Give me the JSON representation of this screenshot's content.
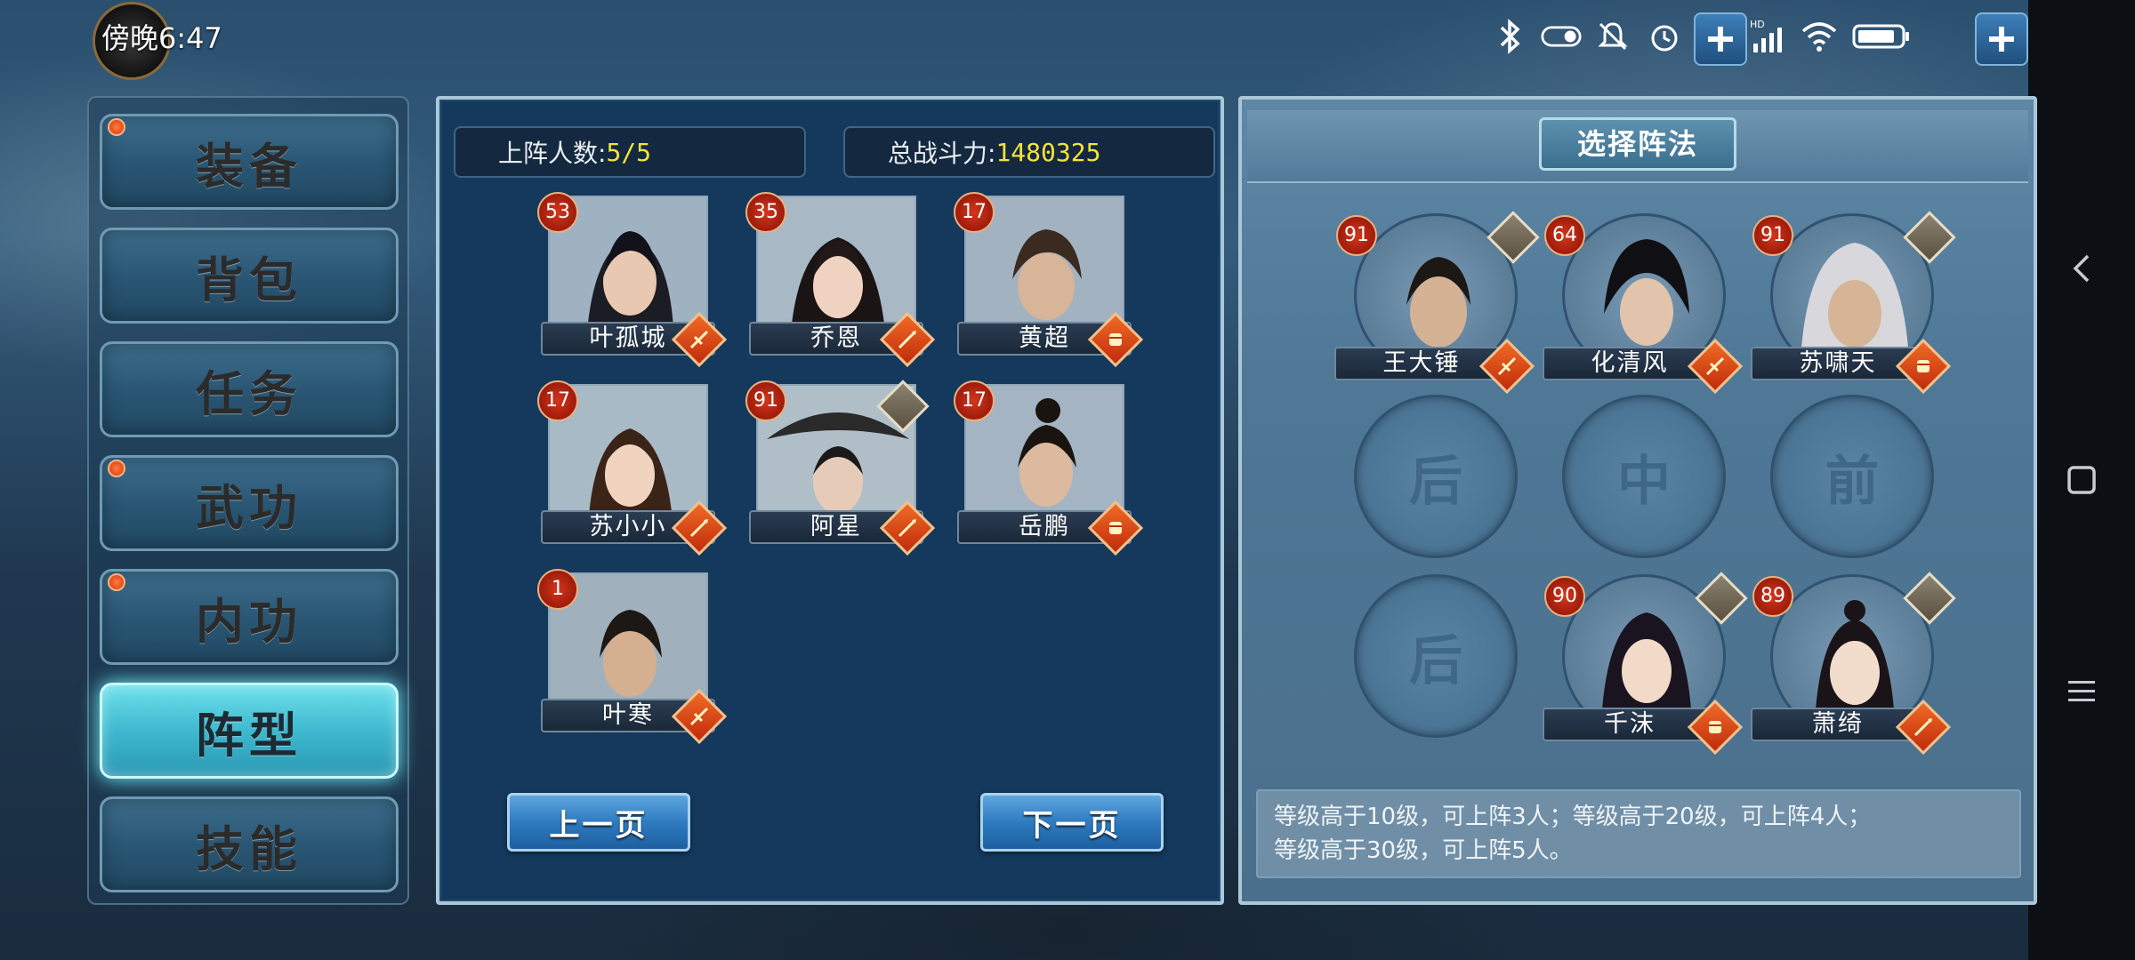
{
  "status_bar": {
    "time": "傍晚6:47",
    "icons": [
      "bluetooth-icon",
      "toggle-icon",
      "mute-icon",
      "alarm-icon",
      "hd-signal-icon",
      "hd-signal-icon",
      "wifi-icon",
      "battery-icon"
    ]
  },
  "menu": {
    "items": [
      {
        "label": "装备",
        "has_dot": true
      },
      {
        "label": "背包",
        "has_dot": false
      },
      {
        "label": "任务",
        "has_dot": false
      },
      {
        "label": "武功",
        "has_dot": true
      },
      {
        "label": "内功",
        "has_dot": true
      },
      {
        "label": "阵型",
        "has_dot": false,
        "active": true
      },
      {
        "label": "技能",
        "has_dot": false
      }
    ]
  },
  "roster": {
    "deploy_label": "上阵人数:",
    "deploy_value": "5/5",
    "power_label": "总战斗力:",
    "power_value": "1480325",
    "heroes": [
      {
        "name": "叶孤城",
        "level": "53",
        "type": "sword"
      },
      {
        "name": "乔恩",
        "level": "35",
        "type": "spear"
      },
      {
        "name": "黄超",
        "level": "17",
        "type": "fist"
      },
      {
        "name": "苏小小",
        "level": "17",
        "type": "spear"
      },
      {
        "name": "阿星",
        "level": "91",
        "type": "spear"
      },
      {
        "name": "岳鹏",
        "level": "17",
        "type": "fist"
      },
      {
        "name": "叶寒",
        "level": "1",
        "type": "sword"
      }
    ],
    "prev_label": "上一页",
    "next_label": "下一页"
  },
  "formation": {
    "title": "选择阵法",
    "slots": [
      {
        "hero": "王大锤",
        "level": "91",
        "type": "sword"
      },
      {
        "hero": "化清风",
        "level": "64",
        "type": "sword"
      },
      {
        "hero": "苏啸天",
        "level": "91",
        "type": "fist"
      },
      {
        "empty_label": "后"
      },
      {
        "empty_label": "中"
      },
      {
        "empty_label": "前"
      },
      {
        "empty_label": "后"
      },
      {
        "hero": "千沫",
        "level": "90",
        "type": "fist"
      },
      {
        "hero": "萧绮",
        "level": "89",
        "type": "spear"
      }
    ],
    "info_line1": "等级高于10级，可上阵3人；等级高于20级，可上阵4人；",
    "info_line2": "等级高于30级，可上阵5人。"
  },
  "colors": {
    "accent_gold": "#f5e23a",
    "active_tab": "#3fb9cf",
    "level_badge": "#c0281a",
    "type_badge": "#e0501a"
  }
}
